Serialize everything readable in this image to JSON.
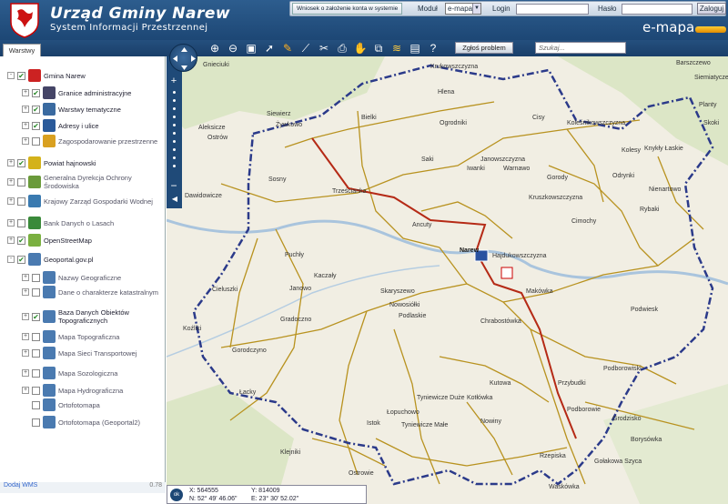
{
  "header": {
    "title": "Urząd Gminy Narew",
    "subtitle": "System Informacji Przestrzennej",
    "request_account_button": "Wniosek o założenie konta w systemie",
    "module_label": "Moduł",
    "module_value": "e-mapa",
    "login_label": "Login",
    "password_label": "Hasło",
    "login_button": "Zaloguj",
    "brand": "e-mapa"
  },
  "toolbar": {
    "tab_layers": "Warstwy",
    "report_button": "Zgłoś problem",
    "search_placeholder": "Szukaj..."
  },
  "layers": [
    {
      "label": "Gmina Narew",
      "expand": "-",
      "checked": true,
      "indent": 0,
      "icon": "coat-of-arms-icon",
      "color": "#cc2222"
    },
    {
      "label": "Granice administracyjne",
      "expand": "+",
      "checked": true,
      "indent": 1,
      "icon": "boundary-icon",
      "color": "#444466"
    },
    {
      "label": "Warstwy tematyczne",
      "expand": "+",
      "checked": true,
      "indent": 1,
      "icon": "layers-icon",
      "color": "#3a6aa0"
    },
    {
      "label": "Adresy i ulice",
      "expand": "+",
      "checked": true,
      "indent": 1,
      "icon": "address-icon",
      "color": "#2a5a9a"
    },
    {
      "label": "Zagospodarowanie przestrzenne",
      "expand": "+",
      "checked": false,
      "indent": 1,
      "icon": "planning-icon",
      "color": "#d9a020"
    },
    {
      "label": "Powiat hajnowski",
      "expand": "+",
      "checked": true,
      "indent": 0,
      "icon": "county-icon",
      "color": "#d4b21a"
    },
    {
      "label": "Generalna Dyrekcja Ochrony Środowiska",
      "expand": "+",
      "checked": false,
      "indent": 0,
      "icon": "environment-icon",
      "color": "#6a9a3a"
    },
    {
      "label": "Krajowy Zarząd Gospodarki Wodnej",
      "expand": "+",
      "checked": false,
      "indent": 0,
      "icon": "water-icon",
      "color": "#3a7ab0"
    },
    {
      "label": "Bank Danych o Lasach",
      "expand": "+",
      "checked": false,
      "indent": 0,
      "icon": "forest-icon",
      "color": "#3a8a3a"
    },
    {
      "label": "OpenStreetMap",
      "expand": "+",
      "checked": true,
      "indent": 0,
      "icon": "osm-icon",
      "color": "#7ab040"
    },
    {
      "label": "Geoportal.gov.pl",
      "expand": "-",
      "checked": true,
      "indent": 0,
      "icon": "geoportal-icon",
      "color": "#4a7ab0"
    },
    {
      "label": "Nazwy Geograficzne",
      "expand": "+",
      "checked": false,
      "indent": 1,
      "icon": "geoportal-icon",
      "color": "#4a7ab0"
    },
    {
      "label": "Dane o charakterze katastralnym",
      "expand": "+",
      "checked": false,
      "indent": 1,
      "icon": "geoportal-icon",
      "color": "#4a7ab0"
    },
    {
      "label": "Baza Danych Obiektów Topograficznych",
      "expand": "+",
      "checked": true,
      "indent": 1,
      "icon": "geoportal-icon",
      "color": "#4a7ab0"
    },
    {
      "label": "Mapa Topograficzna",
      "expand": "+",
      "checked": false,
      "indent": 1,
      "icon": "geoportal-icon",
      "color": "#4a7ab0"
    },
    {
      "label": "Mapa Sieci Transportowej",
      "expand": "+",
      "checked": false,
      "indent": 1,
      "icon": "geoportal-icon",
      "color": "#4a7ab0"
    },
    {
      "label": "Mapa Sozologiczna",
      "expand": "+",
      "checked": false,
      "indent": 1,
      "icon": "geoportal-icon",
      "color": "#4a7ab0"
    },
    {
      "label": "Mapa Hydrograficzna",
      "expand": "+",
      "checked": false,
      "indent": 1,
      "icon": "geoportal-icon",
      "color": "#4a7ab0"
    },
    {
      "label": "Ortofotomapa",
      "expand": "",
      "checked": false,
      "indent": 1,
      "icon": "geoportal-icon",
      "color": "#4a7ab0"
    },
    {
      "label": "Ortofotomapa (Geoportal2)",
      "expand": "",
      "checked": false,
      "indent": 1,
      "icon": "geoportal-icon",
      "color": "#4a7ab0"
    }
  ],
  "footer": {
    "add_wms": "Dodaj WMS",
    "version": "0.78"
  },
  "status": {
    "ok": "ok",
    "x": "X: 564555",
    "y": "Y: 814009",
    "lat": "N: 52° 49' 46.06\"",
    "lon": "E: 23° 30' 52.02\""
  },
  "map": {
    "towns": [
      "Gnieciuki",
      "Krukowszczyzna",
      "Barszczewo",
      "Siemiatycze",
      "Hlena",
      "Planty",
      "Siewierz",
      "Żywkowo",
      "Bielki",
      "Ogrodniki",
      "Cisy",
      "Koleśnikowszczyzna",
      "Skoki",
      "Aleksicze",
      "Ostrów",
      "Saki",
      "Janowszczyzna",
      "Kolesy",
      "Knykły Łaskie",
      "Iwanki",
      "Warnawo",
      "Gorody",
      "Odrynki",
      "Dawidowicze",
      "Sosny",
      "Trześcianka",
      "Kruszkowszczyzna",
      "Nienartowo",
      "Ancuty",
      "Cimochy",
      "Rybaki",
      "Puchły",
      "Narew",
      "Hajdukowszczyzna",
      "Kaczały",
      "Skaryszewo",
      "Makówka",
      "Cieluszki",
      "Janowo",
      "Nowosiółki",
      "Podlaskie",
      "Gradoczno",
      "Chrabostówka",
      "Podwiesk",
      "Kutowa",
      "Przybudki",
      "Gorodczyno",
      "Podborowiski",
      "Łacky",
      "Łopuchowo",
      "Tyniewicze Duże",
      "Kotłówka",
      "Podborowie",
      "Grodzisko",
      "Istok",
      "Tyniewicze Małe",
      "Nowiny",
      "Borysówka",
      "Klejniki",
      "Koźliki",
      "Rzepiska",
      "Gołakowa Szyca",
      "Waśkówka",
      "Ostrowie"
    ],
    "grid_scale": "5 km"
  }
}
